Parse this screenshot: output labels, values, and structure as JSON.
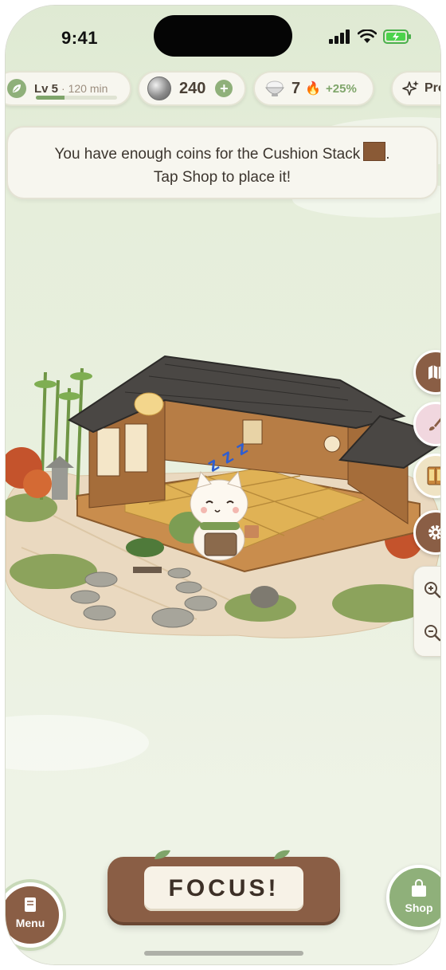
{
  "status_bar": {
    "time": "9:41"
  },
  "hud": {
    "level": {
      "label": "Lv 5",
      "minutes": "· 120 min",
      "progress": 0.35,
      "icon": "leaf-icon"
    },
    "coins": {
      "value": "240",
      "add_label": "+",
      "icon": "coin-icon"
    },
    "streak": {
      "value": "7",
      "flame": "🔥",
      "bonus": "+25%",
      "icon": "rice-bowl-icon"
    },
    "pro": {
      "label": "Pro",
      "icon": "sparkle-icon"
    }
  },
  "toast": {
    "line1": "You have enough coins for the Cushion Stack",
    "line1_end": ".",
    "line2": "Tap Shop to place it!"
  },
  "scene": {
    "sleep_label": "z z z"
  },
  "side_tools": [
    "map-icon",
    "brush-icon",
    "closet-icon",
    "gear-icon",
    "zoom-in-icon",
    "zoom-out-icon"
  ],
  "bottom": {
    "menu_label": "Menu",
    "focus_label": "FOCUS!",
    "shop_label": "Shop"
  },
  "colors": {
    "accent_green": "#8fb07a",
    "wood_brown": "#8a5e45",
    "panel": "#f7f6ef"
  }
}
